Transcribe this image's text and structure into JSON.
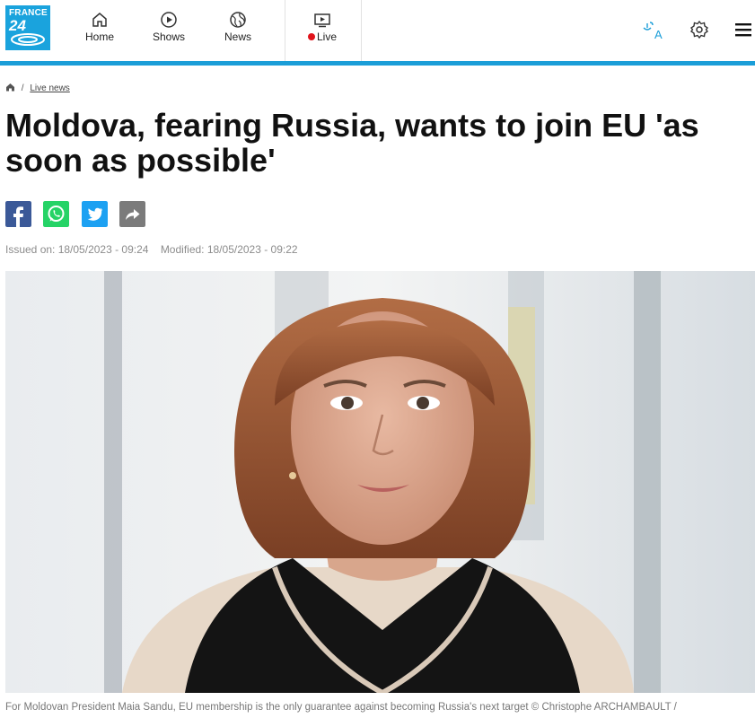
{
  "brand": {
    "logo_line1": "FRANCE",
    "logo_line2": "24"
  },
  "nav": {
    "home": "Home",
    "shows": "Shows",
    "news": "News",
    "live": "Live"
  },
  "header_icons": [
    "translate-icon",
    "settings-gear-icon",
    "menu-hamburger-icon"
  ],
  "colors": {
    "accent": "#1b9ed8",
    "live_dot": "#e0131b",
    "facebook": "#3b5998",
    "whatsapp": "#25d366",
    "twitter": "#1da1f2",
    "share": "#7b7b7b"
  },
  "breadcrumb": {
    "home_icon": "home-icon",
    "separator": "/",
    "section": "Live news"
  },
  "article": {
    "headline": "Moldova, fearing Russia, wants to join EU 'as soon as possible'",
    "issued": "Issued on: 18/05/2023 - 09:24",
    "modified": "Modified: 18/05/2023 - 09:22",
    "caption": "For Moldovan President Maia Sandu, EU membership is the only guarantee against becoming Russia's next target © Christophe ARCHAMBAULT /"
  },
  "share_buttons": [
    "facebook-icon",
    "whatsapp-icon",
    "twitter-icon",
    "share-icon"
  ]
}
